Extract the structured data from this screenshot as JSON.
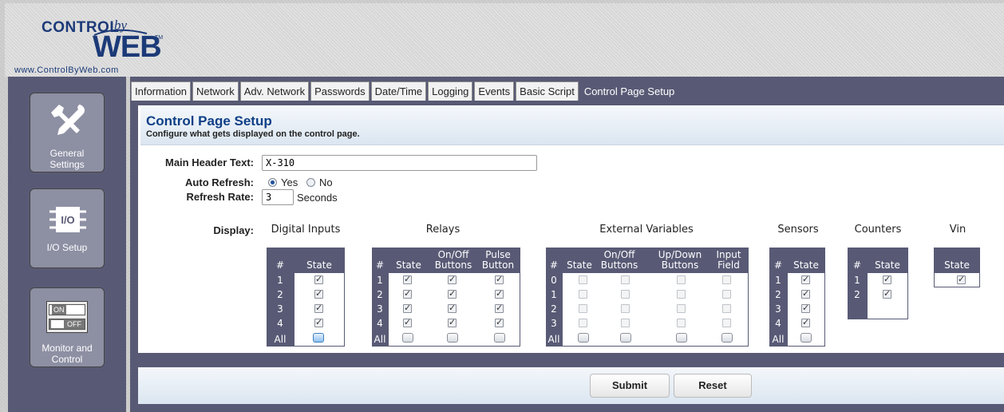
{
  "brand": {
    "name_control": "CONTROL",
    "name_by": "by",
    "name_web": "WEB",
    "tm": "TM",
    "url": "www.ControlByWeb.com"
  },
  "leftnav": {
    "items": [
      {
        "label": "General Settings",
        "icon": "tools-icon"
      },
      {
        "label": "I/O Setup",
        "icon": "chip-icon",
        "icon_text": "I/O"
      },
      {
        "label": "Monitor and Control",
        "icon": "switch-icon",
        "on_text": "ON",
        "off_text": "OFF"
      }
    ]
  },
  "tabs": [
    "Information",
    "Network",
    "Adv. Network",
    "Passwords",
    "Date/Time",
    "Logging",
    "Events",
    "Basic Script",
    "Control Page Setup"
  ],
  "active_tab": "Control Page Setup",
  "panel": {
    "title": "Control Page Setup",
    "subtitle": "Configure what gets displayed on the control page."
  },
  "form": {
    "header_label": "Main Header Text:",
    "header_value": "X-310",
    "refresh_label": "Auto Refresh:",
    "refresh_yes": "Yes",
    "refresh_no": "No",
    "refresh_selected": "Yes",
    "rate_label": "Refresh Rate:",
    "rate_value": "3",
    "rate_unit": "Seconds",
    "display_label": "Display:"
  },
  "groups": {
    "digital_inputs": {
      "title": "Digital Inputs",
      "headers": [
        "#",
        "State"
      ],
      "rows": [
        {
          "num": "1",
          "checks": [
            true
          ]
        },
        {
          "num": "2",
          "checks": [
            true
          ]
        },
        {
          "num": "3",
          "checks": [
            true
          ]
        },
        {
          "num": "4",
          "checks": [
            true
          ]
        }
      ],
      "all_label": "All"
    },
    "relays": {
      "title": "Relays",
      "headers": [
        "#",
        "State",
        "On/Off Buttons",
        "Pulse Button"
      ],
      "headers_line1": [
        "",
        "",
        "On/Off",
        "Pulse"
      ],
      "headers_line2": [
        "#",
        "State",
        "Buttons",
        "Button"
      ],
      "rows": [
        {
          "num": "1",
          "checks": [
            true,
            true,
            true
          ]
        },
        {
          "num": "2",
          "checks": [
            true,
            true,
            true
          ]
        },
        {
          "num": "3",
          "checks": [
            true,
            true,
            true
          ]
        },
        {
          "num": "4",
          "checks": [
            true,
            true,
            true
          ]
        }
      ],
      "all_label": "All"
    },
    "external_variables": {
      "title": "External Variables",
      "headers_line1": [
        "",
        "",
        "On/Off",
        "Up/Down",
        "Input"
      ],
      "headers_line2": [
        "#",
        "State",
        "Buttons",
        "Buttons",
        "Field"
      ],
      "rows": [
        {
          "num": "0",
          "checks": [
            false,
            false,
            false,
            false
          ]
        },
        {
          "num": "1",
          "checks": [
            false,
            false,
            false,
            false
          ]
        },
        {
          "num": "2",
          "checks": [
            false,
            false,
            false,
            false
          ]
        },
        {
          "num": "3",
          "checks": [
            false,
            false,
            false,
            false
          ]
        }
      ],
      "all_label": "All"
    },
    "sensors": {
      "title": "Sensors",
      "headers": [
        "#",
        "State"
      ],
      "rows": [
        {
          "num": "1",
          "checks": [
            true
          ]
        },
        {
          "num": "2",
          "checks": [
            true
          ]
        },
        {
          "num": "3",
          "checks": [
            true
          ]
        },
        {
          "num": "4",
          "checks": [
            true
          ]
        }
      ],
      "all_label": "All"
    },
    "counters": {
      "title": "Counters",
      "headers": [
        "#",
        "State"
      ],
      "rows": [
        {
          "num": "1",
          "checks": [
            true
          ]
        },
        {
          "num": "2",
          "checks": [
            true
          ]
        }
      ]
    },
    "vin": {
      "title": "Vin",
      "headers": [
        "State"
      ],
      "checked": true
    }
  },
  "buttons": {
    "submit": "Submit",
    "reset": "Reset"
  },
  "colors": {
    "nav_bg": "#585a75",
    "title_blue": "#0e3f86",
    "tab_active": "#585a75"
  }
}
